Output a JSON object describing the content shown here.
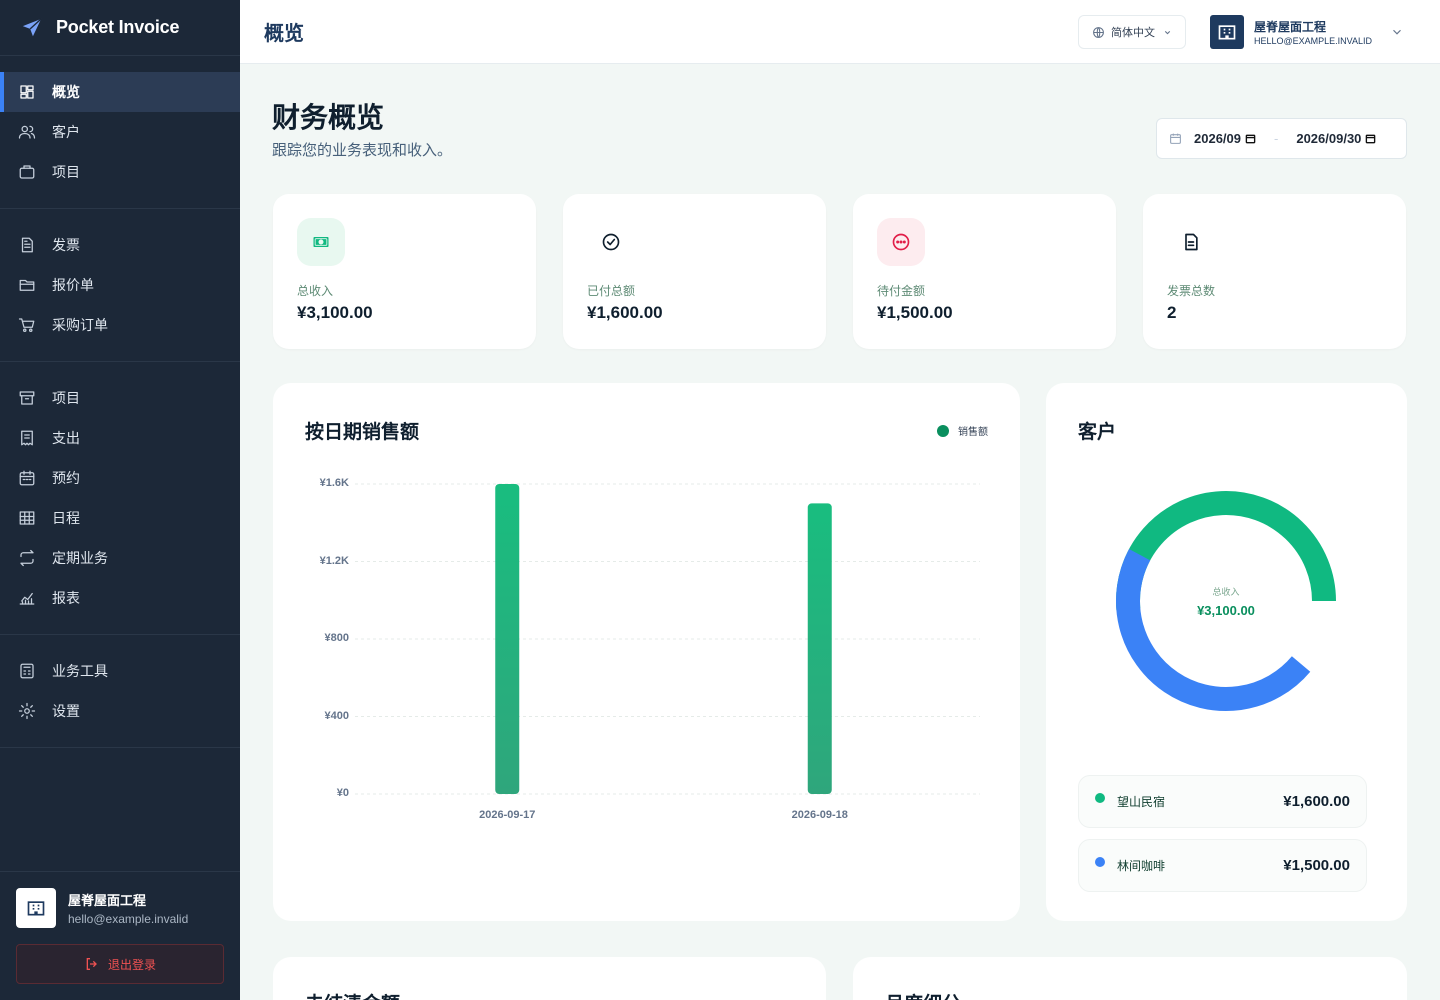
{
  "brand": {
    "name": "Pocket Invoice"
  },
  "nav": {
    "groups": [
      [
        {
          "label": "概览",
          "icon": "dashboard-icon",
          "active": true
        },
        {
          "label": "客户",
          "icon": "users-icon"
        },
        {
          "label": "项目",
          "icon": "briefcase-icon"
        }
      ],
      [
        {
          "label": "发票",
          "icon": "invoice-icon"
        },
        {
          "label": "报价单",
          "icon": "quote-icon"
        },
        {
          "label": "采购订单",
          "icon": "cart-icon"
        }
      ],
      [
        {
          "label": "项目",
          "icon": "archive-icon"
        },
        {
          "label": "支出",
          "icon": "receipt-icon"
        },
        {
          "label": "预约",
          "icon": "calendar-icon"
        },
        {
          "label": "日程",
          "icon": "table-icon"
        },
        {
          "label": "定期业务",
          "icon": "repeat-icon"
        },
        {
          "label": "报表",
          "icon": "chart-icon"
        }
      ],
      [
        {
          "label": "业务工具",
          "icon": "calculator-icon"
        },
        {
          "label": "设置",
          "icon": "gear-icon"
        }
      ]
    ]
  },
  "sidebar_user": {
    "name": "屋脊屋面工程",
    "email": "hello@example.invalid",
    "logout": "退出登录"
  },
  "topbar": {
    "title": "概览",
    "language": "简体中文",
    "account_name": "屋脊屋面工程",
    "account_email": "HELLO@EXAMPLE.INVALID"
  },
  "header": {
    "title": "财务概览",
    "subtitle": "跟踪您的业务表现和收入。"
  },
  "daterange": {
    "from": "2026/09",
    "to": "2026/09/30",
    "separator": "-"
  },
  "stats": [
    {
      "label": "总收入",
      "value": "¥3,100.00",
      "icon": "cash-icon",
      "bg": "#e8f8f0",
      "fg": "#10b981"
    },
    {
      "label": "已付总额",
      "value": "¥1,600.00",
      "icon": "check-circle-icon",
      "bg": "#ffffff",
      "fg": "#0f1f2e"
    },
    {
      "label": "待付金额",
      "value": "¥1,500.00",
      "icon": "pending-icon",
      "bg": "#fdecef",
      "fg": "#e11d48"
    },
    {
      "label": "发票总数",
      "value": "2",
      "icon": "document-icon",
      "bg": "#ffffff",
      "fg": "#0f1f2e"
    }
  ],
  "sales_chart": {
    "title": "按日期销售额",
    "legend": "销售额"
  },
  "chart_data": {
    "type": "bar",
    "title": "按日期销售额",
    "categories": [
      "2026-09-17",
      "2026-09-18"
    ],
    "series": [
      {
        "name": "销售额",
        "values": [
          1600,
          1500
        ],
        "color": "#1db87e"
      }
    ],
    "ylim": [
      0,
      1600
    ],
    "yticks": [
      {
        "v": 1600,
        "label": "¥1.6K"
      },
      {
        "v": 1200,
        "label": "¥1.2K"
      },
      {
        "v": 800,
        "label": "¥800"
      },
      {
        "v": 400,
        "label": "¥400"
      },
      {
        "v": 0,
        "label": "¥0"
      }
    ],
    "grid": true,
    "legend_position": "top-right"
  },
  "customers": {
    "title": "客户",
    "center_label": "总收入",
    "center_value": "¥3,100.00",
    "items": [
      {
        "name": "望山民宿",
        "value": "¥1,600.00",
        "amount": 1600,
        "color": "#10b981"
      },
      {
        "name": "林间咖啡",
        "value": "¥1,500.00",
        "amount": 1500,
        "color": "#3b82f6"
      }
    ]
  },
  "bottom_cards": {
    "left_title": "未结清金额",
    "right_title": "月度细分"
  }
}
